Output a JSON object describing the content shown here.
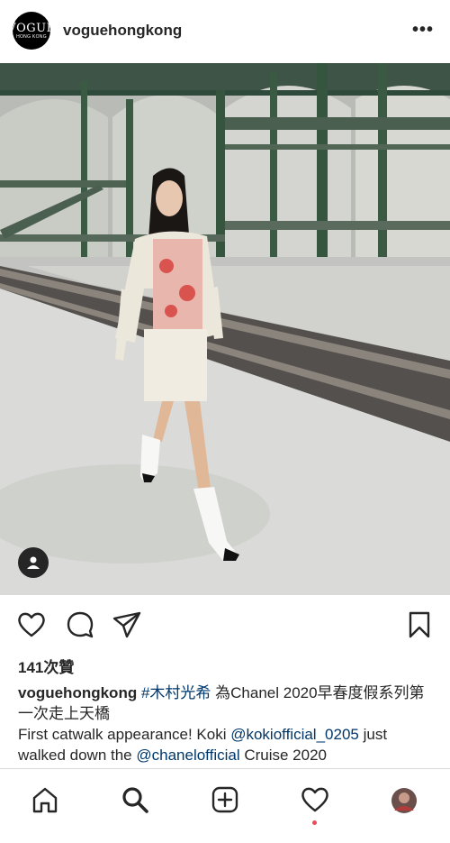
{
  "header": {
    "avatar_line1": "VOGUE",
    "avatar_line2": "HONG KONG",
    "username": "voguehongkong",
    "more_label": "•••"
  },
  "post": {
    "likes": "141次贊",
    "caption_username": "voguehongkong",
    "caption_hashtag": "#木村光希",
    "caption_text1": " 為Chanel 2020早春度假系列第一次走上天橋",
    "caption_text2": "First catwalk appearance! Koki ",
    "caption_mention1": "@kokiofficial_0205",
    "caption_text3": " just walked down the ",
    "caption_mention2": "@chanelofficial",
    "caption_text4": " Cruise 2020"
  },
  "icons": {
    "like": "heart-icon",
    "comment": "comment-icon",
    "share": "paper-plane-icon",
    "save": "bookmark-icon",
    "tag": "person-tag-icon",
    "home": "home-icon",
    "search": "search-icon",
    "add": "add-post-icon",
    "activity": "heart-icon",
    "profile": "profile-avatar"
  },
  "colors": {
    "link": "#00376b",
    "notification_dot": "#ed4956",
    "text": "#262626"
  }
}
